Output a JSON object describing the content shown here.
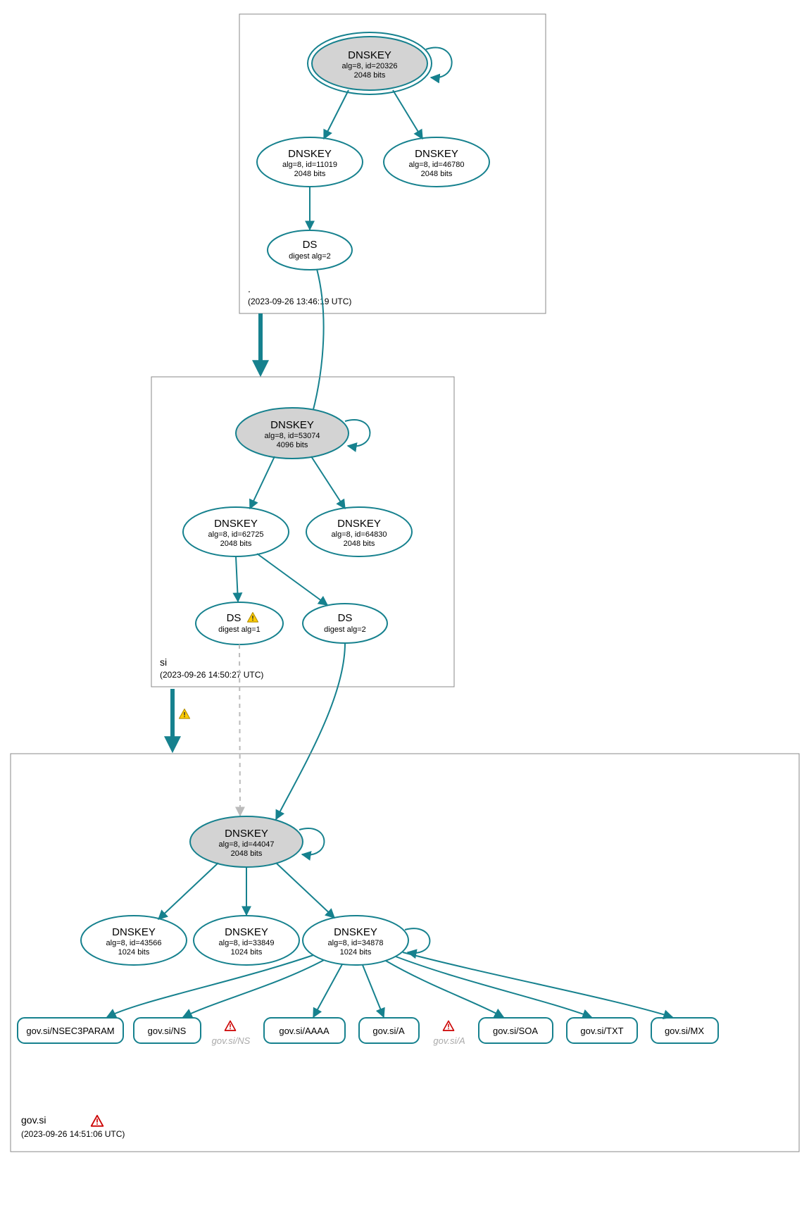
{
  "colors": {
    "stroke": "#16818e",
    "ksk_fill": "#d3d3d3",
    "node_fill": "#ffffff",
    "box_stroke": "#888888",
    "ghost": "#aaaaaa"
  },
  "zones": {
    "root": {
      "name": ".",
      "timestamp": "(2023-09-26 13:46:19 UTC)"
    },
    "si": {
      "name": "si",
      "timestamp": "(2023-09-26 14:50:27 UTC)"
    },
    "govsi": {
      "name": "gov.si",
      "timestamp": "(2023-09-26 14:51:06 UTC)"
    }
  },
  "nodes": {
    "root_ksk": {
      "title": "DNSKEY",
      "line1": "alg=8, id=20326",
      "line2": "2048 bits"
    },
    "root_zsk1": {
      "title": "DNSKEY",
      "line1": "alg=8, id=11019",
      "line2": "2048 bits"
    },
    "root_zsk2": {
      "title": "DNSKEY",
      "line1": "alg=8, id=46780",
      "line2": "2048 bits"
    },
    "root_ds": {
      "title": "DS",
      "line1": "digest alg=2"
    },
    "si_ksk": {
      "title": "DNSKEY",
      "line1": "alg=8, id=53074",
      "line2": "4096 bits"
    },
    "si_zsk1": {
      "title": "DNSKEY",
      "line1": "alg=8, id=62725",
      "line2": "2048 bits"
    },
    "si_zsk2": {
      "title": "DNSKEY",
      "line1": "alg=8, id=64830",
      "line2": "2048 bits"
    },
    "si_ds1": {
      "title": "DS",
      "line1": "digest alg=1"
    },
    "si_ds2": {
      "title": "DS",
      "line1": "digest alg=2"
    },
    "gov_ksk": {
      "title": "DNSKEY",
      "line1": "alg=8, id=44047",
      "line2": "2048 bits"
    },
    "gov_zsk1": {
      "title": "DNSKEY",
      "line1": "alg=8, id=43566",
      "line2": "1024 bits"
    },
    "gov_zsk2": {
      "title": "DNSKEY",
      "line1": "alg=8, id=33849",
      "line2": "1024 bits"
    },
    "gov_zsk3": {
      "title": "DNSKEY",
      "line1": "alg=8, id=34878",
      "line2": "1024 bits"
    }
  },
  "rrsets": {
    "nsec3param": "gov.si/NSEC3PARAM",
    "ns": "gov.si/NS",
    "aaaa": "gov.si/AAAA",
    "a": "gov.si/A",
    "soa": "gov.si/SOA",
    "txt": "gov.si/TXT",
    "mx": "gov.si/MX"
  },
  "ghosts": {
    "ns": "gov.si/NS",
    "a": "gov.si/A"
  }
}
